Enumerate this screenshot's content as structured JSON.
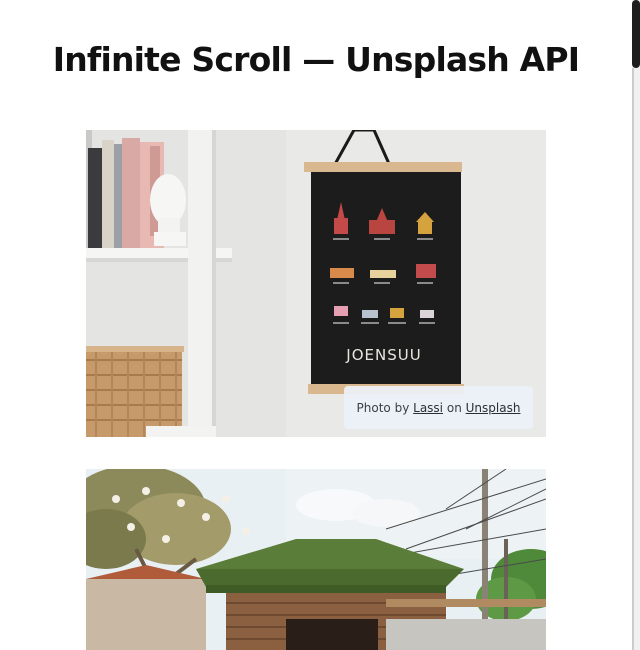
{
  "page": {
    "title": "Infinite Scroll — Unsplash API"
  },
  "photos": [
    {
      "description": "",
      "poster_text": "JOENSUU",
      "credit": {
        "prefix": "Photo by",
        "author": "Lassi",
        "middle": "on",
        "source": "Unsplash"
      }
    },
    {
      "description": ""
    }
  ],
  "colors": {
    "background": "#ffffff",
    "title": "#111111",
    "credit_bg": "#ecf1f7",
    "scroll_thumb": "#1e1e1e"
  }
}
